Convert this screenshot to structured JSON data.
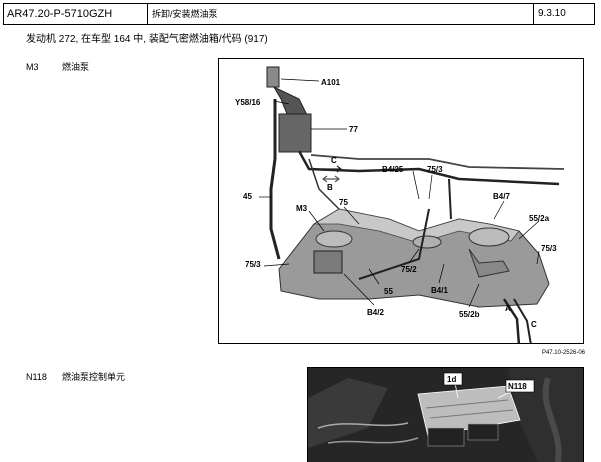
{
  "header": {
    "doc_code": "AR47.20-P-5710GZH",
    "title": "拆卸/安装燃油泵",
    "page_ref": "9.3.10"
  },
  "subtitle": "发动机   272, 在车型 164 中, 装配气密燃油箱/代码 (917)",
  "section1": {
    "code": "M3",
    "label": "燃油泵"
  },
  "section2": {
    "code": "N118",
    "label": "燃油泵控制单元"
  },
  "figure1": {
    "callouts": [
      "A101",
      "Y58/16",
      "77",
      "C",
      "B",
      "B4/25",
      "75/3",
      "B4/7",
      "45",
      "M3",
      "75",
      "55/2a",
      "75/3",
      "75/3",
      "75/2",
      "55",
      "B4/1",
      "B4/2",
      "55/2b",
      "A",
      "C"
    ],
    "figure_code": "P47.10-2526-06"
  },
  "figure2": {
    "callouts": [
      "1d",
      "N118"
    ]
  }
}
